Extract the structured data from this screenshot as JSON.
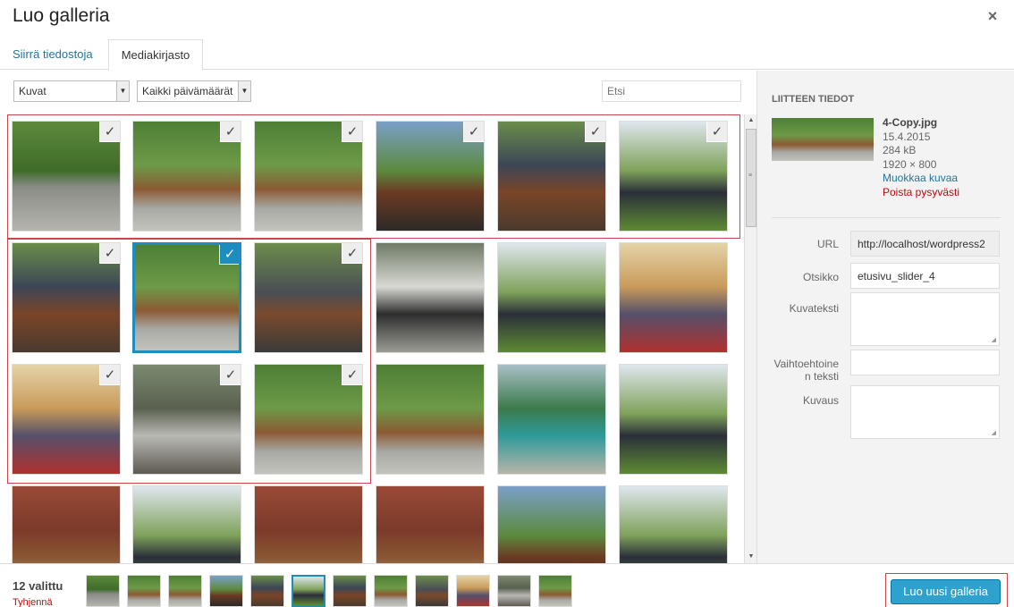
{
  "modal": {
    "title": "Luo galleria",
    "close_glyph": "×"
  },
  "tabs": [
    {
      "label": "Siirrä tiedostoja",
      "active": false
    },
    {
      "label": "Mediakirjasto",
      "active": true
    }
  ],
  "toolbar": {
    "type_filter": "Kuvat",
    "date_filter": "Kaikki päivämäärät",
    "search_placeholder": "Etsi"
  },
  "media": [
    {
      "checked": true,
      "selected": false,
      "scene": "marching-parade"
    },
    {
      "checked": true,
      "selected": false,
      "scene": "riders-street"
    },
    {
      "checked": true,
      "selected": false,
      "scene": "riders-street"
    },
    {
      "checked": true,
      "selected": false,
      "scene": "rider-closeup"
    },
    {
      "checked": true,
      "selected": false,
      "scene": "riders-group"
    },
    {
      "checked": true,
      "selected": false,
      "scene": "riders-flag-field"
    },
    {
      "checked": true,
      "selected": false,
      "scene": "riders-group"
    },
    {
      "checked": true,
      "selected": true,
      "scene": "riders-street"
    },
    {
      "checked": true,
      "selected": false,
      "scene": "riders-crowd"
    },
    {
      "checked": false,
      "selected": false,
      "scene": "white-riders"
    },
    {
      "checked": false,
      "selected": false,
      "scene": "riders-flag-field"
    },
    {
      "checked": false,
      "selected": false,
      "scene": "indoor-people"
    },
    {
      "checked": true,
      "selected": false,
      "scene": "indoor-people"
    },
    {
      "checked": true,
      "selected": false,
      "scene": "street-car"
    },
    {
      "checked": true,
      "selected": false,
      "scene": "riders-street"
    },
    {
      "checked": false,
      "selected": false,
      "scene": "riders-street"
    },
    {
      "checked": false,
      "selected": false,
      "scene": "bridge"
    },
    {
      "checked": false,
      "selected": false,
      "scene": "riders-flag-field"
    },
    {
      "checked": false,
      "selected": false,
      "scene": "brick-riders"
    },
    {
      "checked": false,
      "selected": false,
      "scene": "riders-flag-field"
    },
    {
      "checked": false,
      "selected": false,
      "scene": "brick-riders"
    },
    {
      "checked": false,
      "selected": false,
      "scene": "brick-riders"
    },
    {
      "checked": false,
      "selected": false,
      "scene": "rider-closeup"
    },
    {
      "checked": false,
      "selected": false,
      "scene": "riders-flag-field"
    }
  ],
  "attachment": {
    "heading": "LIITTEEN TIEDOT",
    "filename": "4-Copy.jpg",
    "date": "15.4.2015",
    "size": "284 kB",
    "dimensions": "1920 × 800",
    "edit_link": "Muokkaa kuvaa",
    "delete_link": "Poista pysyvästi",
    "fields": {
      "url_label": "URL",
      "url_value": "http://localhost/wordpress2",
      "title_label": "Otsikko",
      "title_value": "etusivu_slider_4",
      "caption_label": "Kuvateksti",
      "caption_value": "",
      "alt_label_line1": "Vaihtoehtoine",
      "alt_label_line2": "n teksti",
      "alt_value": "",
      "description_label": "Kuvaus",
      "description_value": ""
    }
  },
  "footer": {
    "count_label": "12 valittu",
    "clear_label": "Tyhjennä",
    "create_button": "Luo uusi galleria",
    "selected_thumb_index": 5
  },
  "colors": {
    "accent": "#1e8cbe",
    "button": "#2ea2cc",
    "highlight_box": "#c9474c",
    "link": "#21759b",
    "delete": "#bc0b0b"
  }
}
